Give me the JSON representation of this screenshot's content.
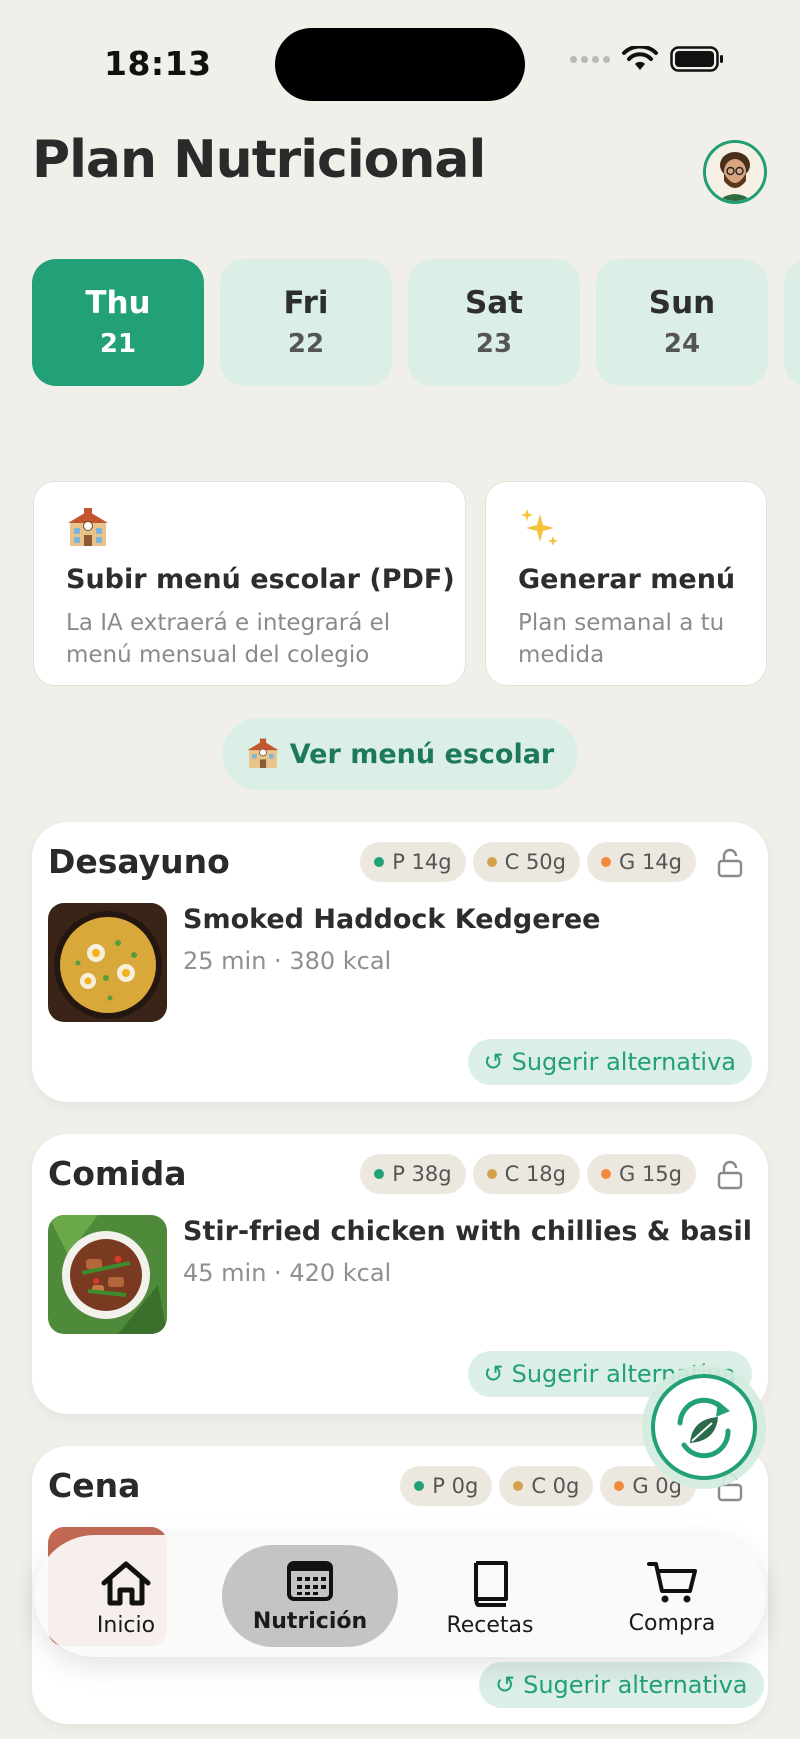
{
  "status_bar": {
    "time": "18:13"
  },
  "header": {
    "title": "Plan Nutricional"
  },
  "days": [
    {
      "name": "Thu",
      "num": "21",
      "active": true
    },
    {
      "name": "Fri",
      "num": "22",
      "active": false
    },
    {
      "name": "Sat",
      "num": "23",
      "active": false
    },
    {
      "name": "Sun",
      "num": "24",
      "active": false
    }
  ],
  "actions": {
    "upload": {
      "icon": "school-icon",
      "title": "Subir menú escolar (PDF)",
      "desc": "La IA extraerá e integrará el menú mensual del colegio"
    },
    "generate": {
      "icon": "sparkles-icon",
      "title": "Generar menú",
      "desc": "Plan semanal a tu medida"
    }
  },
  "school_menu_button": {
    "icon": "school-icon",
    "label": "Ver menú escolar"
  },
  "meals": [
    {
      "title": "Desayuno",
      "protein": "P 14g",
      "carbs": "C 50g",
      "fat": "G 14g",
      "name": "Smoked Haddock Kedgeree",
      "meta": "25 min · 380 kcal",
      "alt_label": "Sugerir alternativa"
    },
    {
      "title": "Comida",
      "protein": "P 38g",
      "carbs": "C 18g",
      "fat": "G 15g",
      "name": "Stir-fried chicken with chillies & basil",
      "meta": "45 min · 420 kcal",
      "alt_label": "Sugerir alternativa"
    },
    {
      "title": "Cena",
      "protein": "P 0g",
      "carbs": "C 0g",
      "fat": "G 0g",
      "alt_label": "Sugerir alternativa"
    }
  ],
  "macro_colors": {
    "protein": "#22a077",
    "carbs": "#d4a24c",
    "fat": "#ef8a3c"
  },
  "tab_bar": {
    "items": [
      {
        "label": "Inicio",
        "icon": "home-icon",
        "active": false
      },
      {
        "label": "Nutrición",
        "icon": "calendar-icon",
        "active": true
      },
      {
        "label": "Recetas",
        "icon": "book-icon",
        "active": false
      },
      {
        "label": "Compra",
        "icon": "cart-icon",
        "active": false
      }
    ]
  },
  "theme": {
    "accent": "#22a077",
    "accent_soft": "#dcefe6",
    "background": "#f1efe9"
  }
}
